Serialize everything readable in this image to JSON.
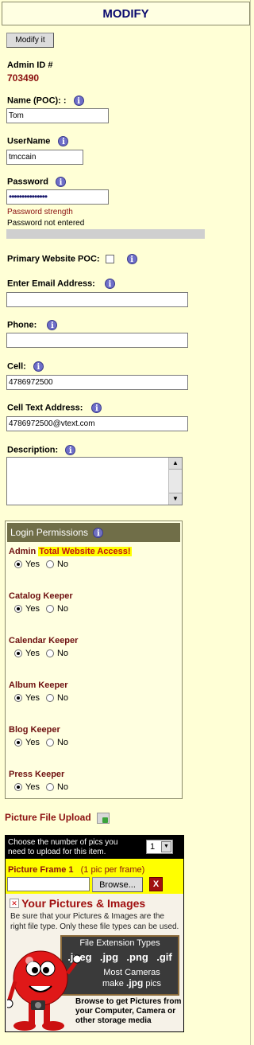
{
  "header": {
    "title": "MODIFY"
  },
  "toolbar": {
    "modify_label": "Modify it"
  },
  "admin": {
    "id_label": "Admin ID #",
    "id_value": "703490"
  },
  "form": {
    "name": {
      "label": "Name (POC): :",
      "value": "Tom"
    },
    "username": {
      "label": "UserName",
      "value": "tmccain"
    },
    "password": {
      "label": "Password",
      "value": "•••••••••••••••",
      "strength_label": "Password strength",
      "status": "Password not entered"
    },
    "primary_poc": {
      "label": "Primary Website POC:",
      "checked": false
    },
    "email": {
      "label": "Enter Email Address:",
      "value": ""
    },
    "phone": {
      "label": "Phone:",
      "value": ""
    },
    "cell": {
      "label": "Cell:",
      "value": "4786972500"
    },
    "cell_text": {
      "label": "Cell Text Address:",
      "value": "4786972500@vtext.com"
    },
    "description": {
      "label": "Description:",
      "value": ""
    }
  },
  "permissions": {
    "title": "Login Permissions",
    "yes_label": "Yes",
    "no_label": "No",
    "items": [
      {
        "name": "Admin",
        "highlight": "Total Website Access!",
        "value": "Yes"
      },
      {
        "name": "Catalog Keeper",
        "highlight": "",
        "value": "Yes"
      },
      {
        "name": "Calendar Keeper",
        "highlight": "",
        "value": "Yes"
      },
      {
        "name": "Album Keeper",
        "highlight": "",
        "value": "Yes"
      },
      {
        "name": "Blog Keeper",
        "highlight": "",
        "value": "Yes"
      },
      {
        "name": "Press Keeper",
        "highlight": "",
        "value": "Yes"
      }
    ]
  },
  "upload": {
    "title": "Picture File Upload",
    "count_prompt": "Choose the number of pics you need to upload for this item.",
    "count_value": "1",
    "frame_title": "Picture Frame 1",
    "frame_note": "(1 pic per frame)",
    "browse_label": "Browse...",
    "remove_label": "X",
    "banner": {
      "heading": "Your Pictures & Images",
      "intro": "Be sure that your Pictures & Images are the right file type.  Only these file types can be used.",
      "types_title": "File Extension Types",
      "types": [
        ".jpeg",
        ".jpg",
        ".png",
        ".gif"
      ],
      "cameras_line1": "Most Cameras",
      "cameras_line2_prefix": "make",
      "cameras_line2_ext": ".jpg",
      "cameras_line2_suffix": "pics",
      "browse_hint": "Browse to get Pictures from your Computer, Camera or other storage media"
    }
  },
  "colors": {
    "background": "#ffffd6",
    "title_text": "#0a0a6e",
    "accent_red": "#8b1010",
    "header_bar": "#706e48",
    "highlight": "#ffff00"
  }
}
